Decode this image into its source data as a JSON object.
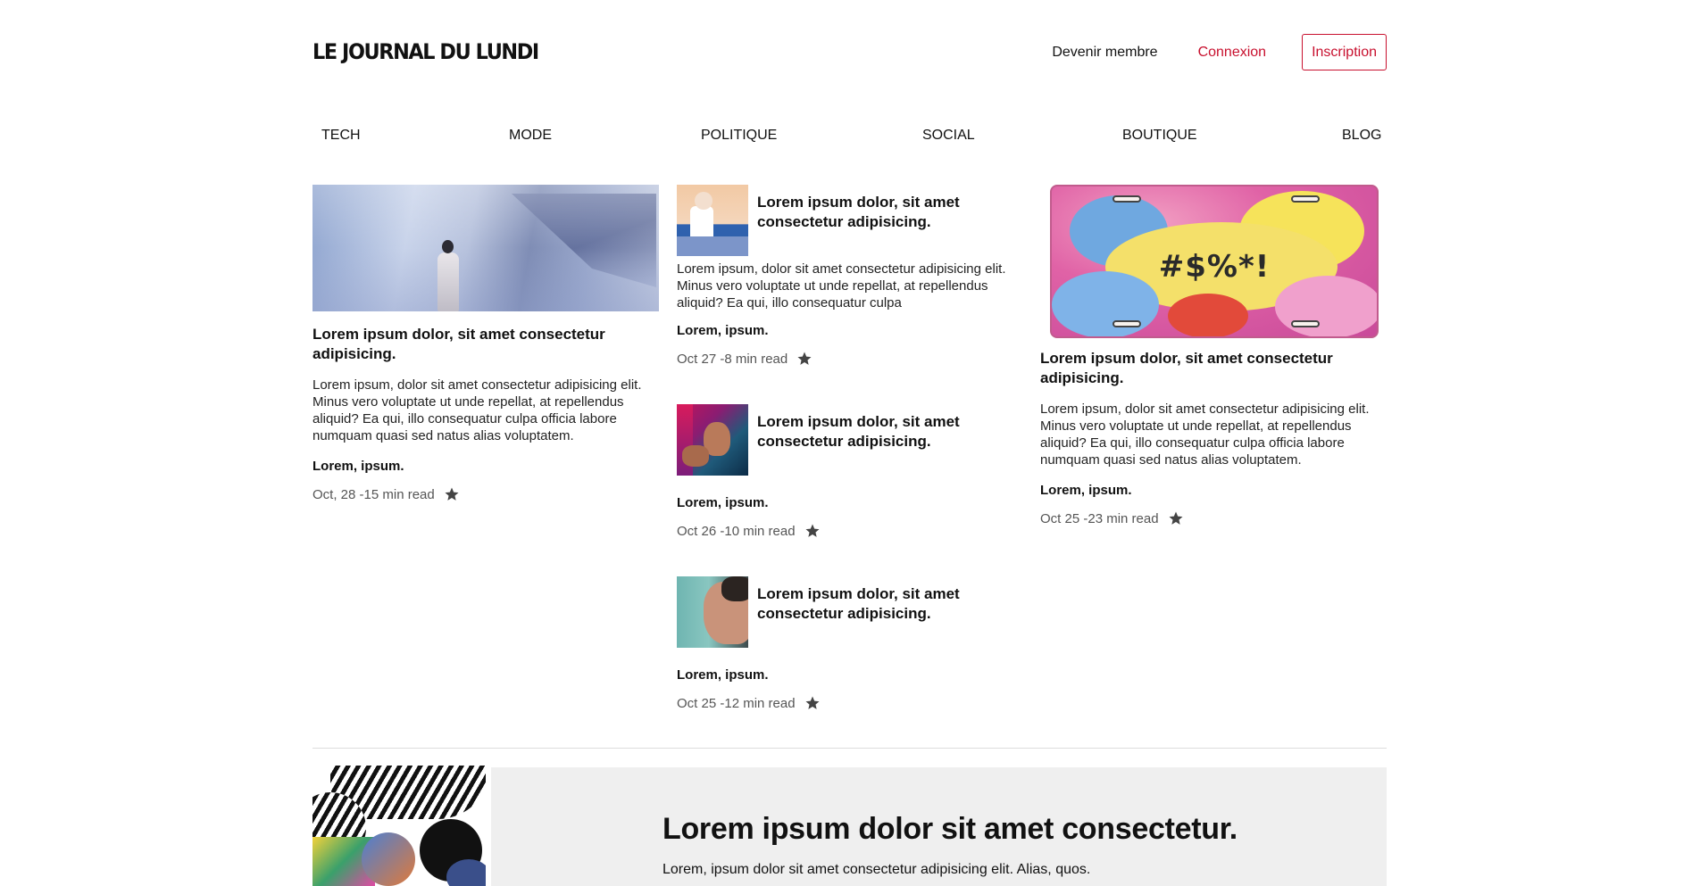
{
  "header": {
    "logo": "LE JOURNAL DU LUNDI",
    "member_link": "Devenir membre",
    "login_link": "Connexion",
    "signup_button": "Inscription"
  },
  "nav": [
    "TECH",
    "MODE",
    "POLITIQUE",
    "SOCIAL",
    "BOUTIQUE",
    "BLOG"
  ],
  "featured_left": {
    "title": "Lorem ipsum dolor, sit amet consectetur adipisicing.",
    "excerpt": "Lorem ipsum, dolor sit amet consectetur adipisicing elit. Minus vero voluptate ut unde repellat, at repellendus aliquid? Ea qui, illo consequatur culpa officia labore numquam quasi sed natus alias voluptatem.",
    "author": "Lorem, ipsum.",
    "meta": "Oct, 28 -15 min read"
  },
  "middle": [
    {
      "title": "Lorem ipsum dolor, sit amet consectetur adipisicing.",
      "excerpt": "Lorem ipsum, dolor sit amet consectetur adipisicing elit. Minus vero voluptate ut unde repellat, at repellendus aliquid? Ea qui, illo consequatur culpa",
      "author": "Lorem, ipsum.",
      "meta": "Oct 27 -8 min read"
    },
    {
      "title": "Lorem ipsum dolor, sit amet consectetur adipisicing.",
      "author": "Lorem, ipsum.",
      "meta": "Oct 26 -10 min read"
    },
    {
      "title": "Lorem ipsum dolor, sit amet consectetur adipisicing.",
      "author": "Lorem, ipsum.",
      "meta": "Oct 25 -12 min read"
    }
  ],
  "featured_right": {
    "image_text": "#$%*!",
    "title": "Lorem ipsum dolor, sit amet consectetur adipisicing.",
    "excerpt": "Lorem ipsum, dolor sit amet consectetur adipisicing elit. Minus vero voluptate ut unde repellat, at repellendus aliquid? Ea qui, illo consequatur culpa officia labore numquam quasi sed natus alias voluptatem.",
    "author": "Lorem, ipsum.",
    "meta": "Oct 25 -23 min read"
  },
  "banner": {
    "title": "Lorem ipsum dolor sit amet consectetur.",
    "subtitle": "Lorem, ipsum dolor sit amet consectetur adipisicing elit. Alias, quos."
  },
  "colors": {
    "accent": "#c8102e",
    "star": "#444444",
    "banner_bg": "#efefef"
  },
  "icons": {
    "bookmark": "star-icon"
  }
}
